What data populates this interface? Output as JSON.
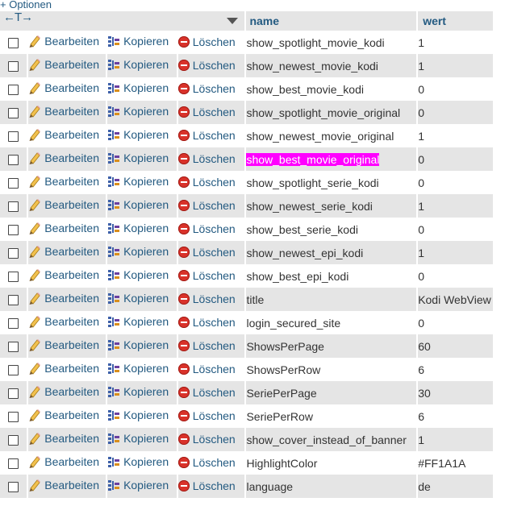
{
  "options_label": "+ Optionen",
  "header": {
    "arrows": "←T→",
    "name_col": "name",
    "value_col": "wert"
  },
  "actions": {
    "edit": "Bearbeiten",
    "copy": "Kopieren",
    "delete": "Löschen"
  },
  "highlight_color": "#ff00ff",
  "rows": [
    {
      "name": "show_spotlight_movie_kodi",
      "value": "1",
      "highlighted": false
    },
    {
      "name": "show_newest_movie_kodi",
      "value": "1",
      "highlighted": false
    },
    {
      "name": "show_best_movie_kodi",
      "value": "0",
      "highlighted": false
    },
    {
      "name": "show_spotlight_movie_original",
      "value": "0",
      "highlighted": false
    },
    {
      "name": "show_newest_movie_original",
      "value": "1",
      "highlighted": false
    },
    {
      "name": "show_best_movie_original",
      "value": "0",
      "highlighted": true
    },
    {
      "name": "show_spotlight_serie_kodi",
      "value": "0",
      "highlighted": false
    },
    {
      "name": "show_newest_serie_kodi",
      "value": "1",
      "highlighted": false
    },
    {
      "name": "show_best_serie_kodi",
      "value": "0",
      "highlighted": false
    },
    {
      "name": "show_newest_epi_kodi",
      "value": "1",
      "highlighted": false
    },
    {
      "name": "show_best_epi_kodi",
      "value": "0",
      "highlighted": false
    },
    {
      "name": "title",
      "value": "Kodi WebView",
      "highlighted": false
    },
    {
      "name": "login_secured_site",
      "value": "0",
      "highlighted": false
    },
    {
      "name": "ShowsPerPage",
      "value": "60",
      "highlighted": false
    },
    {
      "name": "ShowsPerRow",
      "value": "6",
      "highlighted": false
    },
    {
      "name": "SeriePerPage",
      "value": "30",
      "highlighted": false
    },
    {
      "name": "SeriePerRow",
      "value": "6",
      "highlighted": false
    },
    {
      "name": "show_cover_instead_of_banner",
      "value": "1",
      "highlighted": false
    },
    {
      "name": "HighlightColor",
      "value": "#FF1A1A",
      "highlighted": false
    },
    {
      "name": "language",
      "value": "de",
      "highlighted": false
    }
  ]
}
